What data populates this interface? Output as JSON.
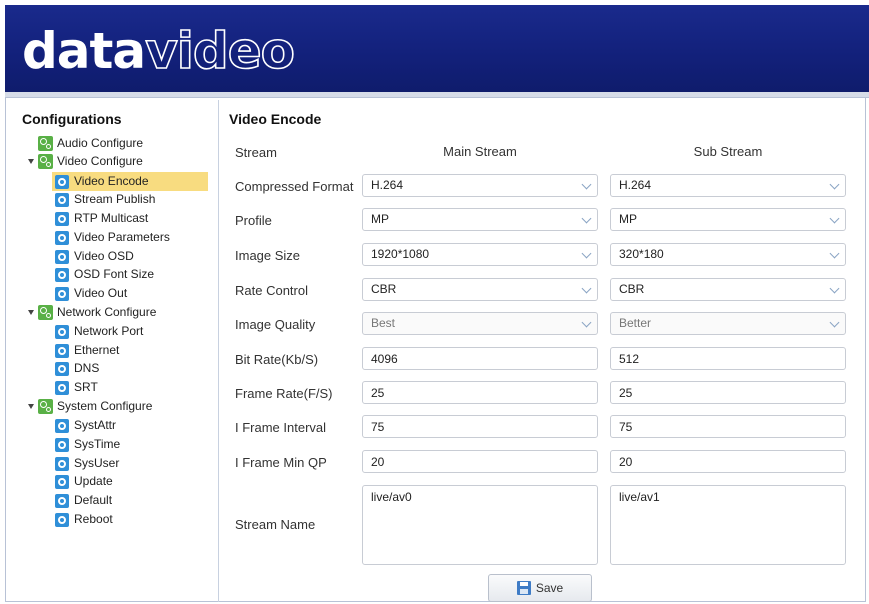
{
  "brand": {
    "logo_bold": "data",
    "logo_light": "video"
  },
  "sidebar": {
    "title": "Configurations",
    "items": [
      {
        "label": "Audio Configure",
        "icon": "gear-group-icon",
        "level": 0
      },
      {
        "label": "Video Configure",
        "icon": "gear-group-icon",
        "level": 0,
        "expanded": true
      },
      {
        "label": "Video Encode",
        "icon": "settings-icon",
        "level": 1,
        "selected": true
      },
      {
        "label": "Stream Publish",
        "icon": "settings-icon",
        "level": 1
      },
      {
        "label": "RTP Multicast",
        "icon": "settings-icon",
        "level": 1
      },
      {
        "label": "Video Parameters",
        "icon": "settings-icon",
        "level": 1
      },
      {
        "label": "Video OSD",
        "icon": "settings-icon",
        "level": 1
      },
      {
        "label": "OSD Font Size",
        "icon": "settings-icon",
        "level": 1
      },
      {
        "label": "Video Out",
        "icon": "settings-icon",
        "level": 1
      },
      {
        "label": "Network Configure",
        "icon": "gear-group-icon",
        "level": 0,
        "expanded": true
      },
      {
        "label": "Network Port",
        "icon": "settings-icon",
        "level": 1
      },
      {
        "label": "Ethernet",
        "icon": "settings-icon",
        "level": 1
      },
      {
        "label": "DNS",
        "icon": "settings-icon",
        "level": 1
      },
      {
        "label": "SRT",
        "icon": "settings-icon",
        "level": 1
      },
      {
        "label": "System Configure",
        "icon": "gear-group-icon",
        "level": 0,
        "expanded": true
      },
      {
        "label": "SystAttr",
        "icon": "settings-icon",
        "level": 1
      },
      {
        "label": "SysTime",
        "icon": "settings-icon",
        "level": 1
      },
      {
        "label": "SysUser",
        "icon": "settings-icon",
        "level": 1
      },
      {
        "label": "Update",
        "icon": "settings-icon",
        "level": 1
      },
      {
        "label": "Default",
        "icon": "settings-icon",
        "level": 1
      },
      {
        "label": "Reboot",
        "icon": "settings-icon",
        "level": 1
      }
    ]
  },
  "main": {
    "title": "Video Encode",
    "headers": {
      "stream": "Stream",
      "main": "Main Stream",
      "sub": "Sub Stream"
    },
    "rows": {
      "compressed_format": {
        "label": "Compressed Format",
        "main": "H.264",
        "sub": "H.264"
      },
      "profile": {
        "label": "Profile",
        "main": "MP",
        "sub": "MP"
      },
      "image_size": {
        "label": "Image Size",
        "main": "1920*1080",
        "sub": "320*180"
      },
      "rate_control": {
        "label": "Rate Control",
        "main": "CBR",
        "sub": "CBR"
      },
      "image_quality": {
        "label": "Image Quality",
        "main": "Best",
        "sub": "Better"
      },
      "bit_rate": {
        "label": "Bit Rate(Kb/S)",
        "main": "4096",
        "sub": "512"
      },
      "frame_rate": {
        "label": "Frame Rate(F/S)",
        "main": "25",
        "sub": "25"
      },
      "i_frame_interval": {
        "label": "I Frame Interval",
        "main": "75",
        "sub": "75"
      },
      "i_frame_min_qp": {
        "label": "I Frame Min QP",
        "main": "20",
        "sub": "20"
      },
      "stream_name": {
        "label": "Stream Name",
        "main": "live/av0",
        "sub": "live/av1"
      }
    },
    "save_label": "Save"
  },
  "colors": {
    "header_bg": "#12207a",
    "selected_bg": "#f8dc80",
    "group_icon": "#59b046",
    "item_icon": "#2f8fd8"
  }
}
